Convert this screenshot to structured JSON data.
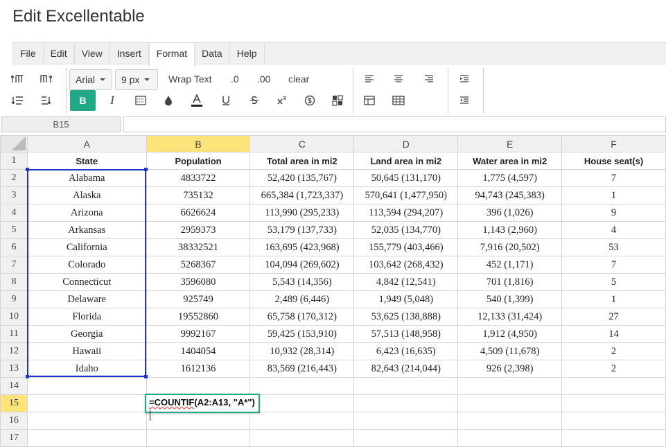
{
  "app": {
    "title": "Edit Excellentable"
  },
  "menu": [
    "File",
    "Edit",
    "View",
    "Insert",
    "Format",
    "Data",
    "Help"
  ],
  "menu_active": "Format",
  "toolbar": {
    "font": "Arial",
    "size": "9 px",
    "wrap_text": "Wrap Text",
    "dec_less": ".0",
    "dec_more": ".00",
    "clear": "clear",
    "bold": "B",
    "italic": "I"
  },
  "cell_ref": "B15",
  "columns": [
    "A",
    "B",
    "C",
    "D",
    "E",
    "F"
  ],
  "row_numbers": [
    "1",
    "2",
    "3",
    "4",
    "5",
    "6",
    "7",
    "8",
    "9",
    "10",
    "11",
    "12",
    "13",
    "14",
    "15",
    "16",
    "17"
  ],
  "rows": [
    [
      "State",
      "Population",
      "Total area in mi2",
      "Land area in mi2",
      "Water area in mi2",
      "House seat(s)"
    ],
    [
      "Alabama",
      "4833722",
      "52,420 (135,767)",
      "50,645 (131,170)",
      "1,775 (4,597)",
      "7"
    ],
    [
      "Alaska",
      "735132",
      "665,384 (1,723,337)",
      "570,641 (1,477,950)",
      "94,743 (245,383)",
      "1"
    ],
    [
      "Arizona",
      "6626624",
      "113,990 (295,233)",
      "113,594 (294,207)",
      "396 (1,026)",
      "9"
    ],
    [
      "Arkansas",
      "2959373",
      "53,179 (137,733)",
      "52,035 (134,770)",
      "1,143 (2,960)",
      "4"
    ],
    [
      "California",
      "38332521",
      "163,695 (423,968)",
      "155,779 (403,466)",
      "7,916 (20,502)",
      "53"
    ],
    [
      "Colorado",
      "5268367",
      "104,094 (269,602)",
      "103,642 (268,432)",
      "452 (1,171)",
      "7"
    ],
    [
      "Connecticut",
      "3596080",
      "5,543 (14,356)",
      "4,842 (12,541)",
      "701 (1,816)",
      "5"
    ],
    [
      "Delaware",
      "925749",
      "2,489 (6,446)",
      "1,949 (5,048)",
      "540 (1,399)",
      "1"
    ],
    [
      "Florida",
      "19552860",
      "65,758 (170,312)",
      "53,625 (138,888)",
      "12,133 (31,424)",
      "27"
    ],
    [
      "Georgia",
      "9992167",
      "59,425 (153,910)",
      "57,513 (148,958)",
      "1,912 (4,950)",
      "14"
    ],
    [
      "Hawaii",
      "1404054",
      "10,932 (28,314)",
      "6,423 (16,635)",
      "4,509 (11,678)",
      "2"
    ],
    [
      "Idaho",
      "1612136",
      "83,569 (216,443)",
      "82,643 (214,044)",
      "926 (2,398)",
      "2"
    ],
    [
      "",
      "",
      "",
      "",
      "",
      ""
    ],
    [
      "",
      "",
      "",
      "",
      "",
      ""
    ],
    [
      "",
      "",
      "",
      "",
      "",
      ""
    ],
    [
      "",
      "",
      "",
      "",
      "",
      ""
    ]
  ],
  "edit": {
    "func": "=COUNTIF",
    "args": "(A2:A13, \"A*\")"
  },
  "colors": {
    "accent": "#22a887",
    "selection": "#2233cc",
    "header_highlight": "#fce37a"
  }
}
